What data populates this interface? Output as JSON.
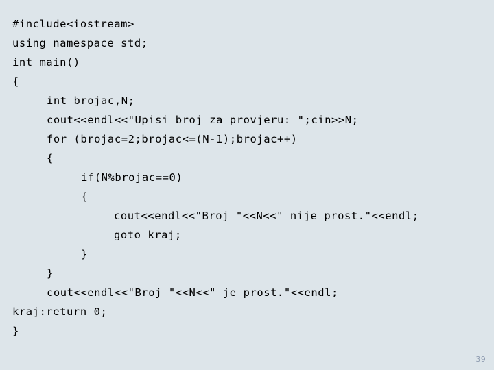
{
  "slide": {
    "background_color": "#dde5ea",
    "text_color": "#000000",
    "page_number": "39",
    "page_number_color": "#8e9bb0"
  },
  "code": {
    "language": "cpp",
    "lines": [
      {
        "indent": 0,
        "text": "#include<iostream>"
      },
      {
        "indent": 0,
        "text": "using namespace std;"
      },
      {
        "indent": 0,
        "text": "int main()"
      },
      {
        "indent": 0,
        "text": "{"
      },
      {
        "indent": 1,
        "text": "int brojac,N;"
      },
      {
        "indent": 1,
        "text": "cout<<endl<<\"Upisi broj za provjeru: \";cin>>N;"
      },
      {
        "indent": 1,
        "text": "for (brojac=2;brojac<=(N-1);brojac++)"
      },
      {
        "indent": 1,
        "text": "{"
      },
      {
        "indent": 2,
        "text": "if(N%brojac==0)"
      },
      {
        "indent": 2,
        "text": "{"
      },
      {
        "indent": 3,
        "text": "cout<<endl<<\"Broj \"<<N<<\" nije prost.\"<<endl;"
      },
      {
        "indent": 3,
        "text": "goto kraj;"
      },
      {
        "indent": 2,
        "text": "}"
      },
      {
        "indent": 1,
        "text": "}"
      },
      {
        "indent": 1,
        "text": "cout<<endl<<\"Broj \"<<N<<\" je prost.\"<<endl;"
      },
      {
        "indent": 0,
        "text": "kraj:return 0;"
      },
      {
        "indent": 0,
        "text": "}"
      }
    ]
  }
}
